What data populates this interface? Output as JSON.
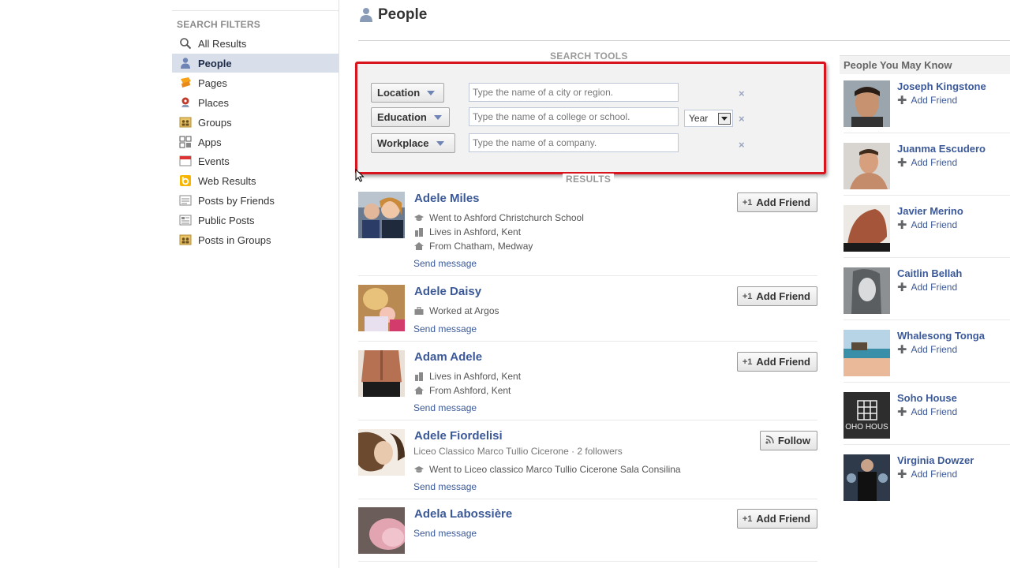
{
  "sidebar": {
    "heading": "SEARCH FILTERS",
    "items": [
      {
        "label": "All Results",
        "icon": "magnifier-icon"
      },
      {
        "label": "People",
        "icon": "person-icon",
        "active": true
      },
      {
        "label": "Pages",
        "icon": "flag-icon"
      },
      {
        "label": "Places",
        "icon": "map-pin-icon"
      },
      {
        "label": "Groups",
        "icon": "group-icon"
      },
      {
        "label": "Apps",
        "icon": "apps-icon"
      },
      {
        "label": "Events",
        "icon": "calendar-icon"
      },
      {
        "label": "Web Results",
        "icon": "bing-icon"
      },
      {
        "label": "Posts by Friends",
        "icon": "posts-icon"
      },
      {
        "label": "Public Posts",
        "icon": "public-posts-icon"
      },
      {
        "label": "Posts in Groups",
        "icon": "group-posts-icon"
      }
    ]
  },
  "header": {
    "title": "People"
  },
  "search_tools": {
    "label": "SEARCH TOOLS",
    "location": {
      "label": "Location",
      "placeholder": "Type the name of a city or region."
    },
    "education": {
      "label": "Education",
      "placeholder": "Type the name of a college or school.",
      "year": "Year"
    },
    "workplace": {
      "label": "Workplace",
      "placeholder": "Type the name of a company."
    },
    "clear": "×"
  },
  "results_label": "RESULTS",
  "results": [
    {
      "name": "Adele Miles",
      "details": [
        "Went to Ashford Christchurch School",
        "Lives in Ashford, Kent",
        "From Chatham, Medway"
      ],
      "message": "Send message",
      "action": "Add Friend"
    },
    {
      "name": "Adele Daisy",
      "details": [
        "Worked at Argos"
      ],
      "message": "Send message",
      "action": "Add Friend"
    },
    {
      "name": "Adam Adele",
      "details": [
        "Lives in Ashford, Kent",
        "From Ashford, Kent"
      ],
      "message": "Send message",
      "action": "Add Friend"
    },
    {
      "name": "Adele Fiordelisi",
      "subtitle": "Liceo Classico Marco Tullio Cicerone · 2 followers",
      "details": [
        "Went to Liceo classico Marco Tullio Cicerone Sala Consilina"
      ],
      "message": "Send message",
      "action": "Follow"
    },
    {
      "name": "Adela Labossière",
      "details": [],
      "message": "Send message",
      "action": "Add Friend"
    }
  ],
  "pymk": {
    "heading": "People You May Know",
    "add_label": "Add Friend",
    "people": [
      {
        "name": "Joseph Kingstone"
      },
      {
        "name": "Juanma Escudero"
      },
      {
        "name": "Javier Merino"
      },
      {
        "name": "Caitlin Bellah"
      },
      {
        "name": "Whalesong Tonga"
      },
      {
        "name": "Soho House",
        "pic_text": "OHO HOUS"
      },
      {
        "name": "Virginia Dowzer"
      }
    ]
  },
  "colors": {
    "link": "#3b5998",
    "highlight_border": "#d8141f",
    "active_filter_bg": "#d8dfea"
  }
}
